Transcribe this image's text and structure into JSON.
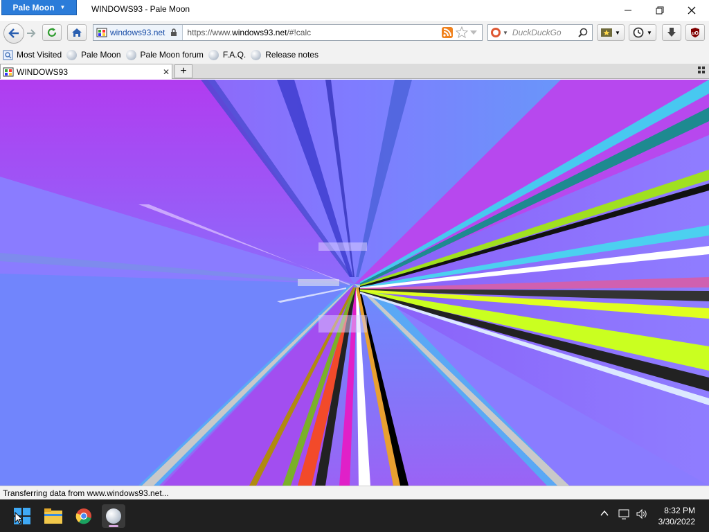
{
  "window": {
    "app_menu_label": "Pale Moon",
    "title": "WINDOWS93 - Pale Moon"
  },
  "navbar": {
    "identity_label": "windows93.net",
    "url_prefix": "https://www.",
    "url_host": "windows93.net",
    "url_suffix": "/#!calc",
    "search_placeholder": "DuckDuckGo"
  },
  "bookmarks": [
    {
      "label": "Most Visited"
    },
    {
      "label": "Pale Moon"
    },
    {
      "label": "Pale Moon forum"
    },
    {
      "label": "F.A.Q."
    },
    {
      "label": "Release notes"
    }
  ],
  "tab": {
    "title": "WINDOWS93",
    "close": "✕",
    "new_tab": "+"
  },
  "status": {
    "text": "Transferring data from www.windows93.net..."
  },
  "taskbar": {
    "time": "8:32 PM",
    "date": "3/30/2022"
  },
  "colors": {
    "app_menu": "#2b7cd9",
    "taskbar": "#202020",
    "content_magenta": "#b13cf0",
    "content_blue": "#5aa4f6",
    "content_violet": "#8a7cff"
  }
}
